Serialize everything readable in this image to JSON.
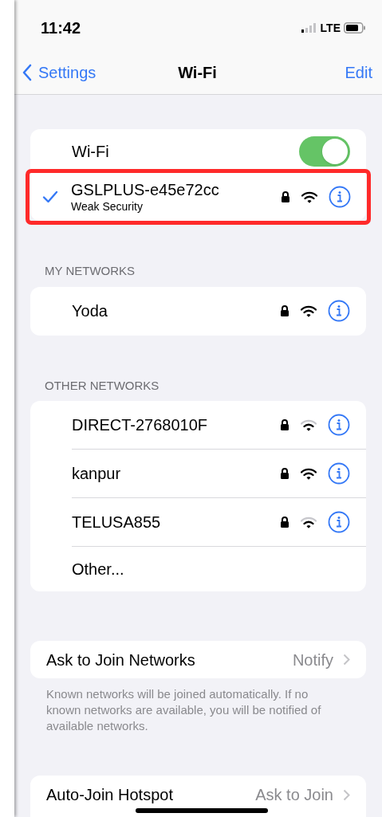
{
  "status_bar": {
    "time": "11:42",
    "carrier": "LTE"
  },
  "nav": {
    "back": "Settings",
    "title": "Wi-Fi",
    "action": "Edit"
  },
  "wifi_switch": {
    "label": "Wi-Fi",
    "on": true
  },
  "current_network": {
    "name": "GSLPLUS-e45e72cc",
    "subtitle": "Weak Security",
    "checked": true,
    "locked": true,
    "strong_signal": true,
    "highlighted": true
  },
  "my_networks": {
    "header": "MY NETWORKS",
    "items": [
      {
        "name": "Yoda",
        "locked": true,
        "strong_signal": true
      }
    ]
  },
  "other_networks": {
    "header": "OTHER NETWORKS",
    "items": [
      {
        "name": "DIRECT-2768010F",
        "locked": true,
        "strong_signal": false
      },
      {
        "name": "kanpur",
        "locked": true,
        "strong_signal": true
      },
      {
        "name": "TELUSA855",
        "locked": true,
        "strong_signal": false
      }
    ],
    "other": "Other..."
  },
  "ask_to_join": {
    "label": "Ask to Join Networks",
    "value": "Notify",
    "footnote": "Known networks will be joined automatically. If no known networks are available, you will be notified of available networks."
  },
  "auto_join": {
    "label": "Auto-Join Hotspot",
    "value": "Ask to Join"
  }
}
